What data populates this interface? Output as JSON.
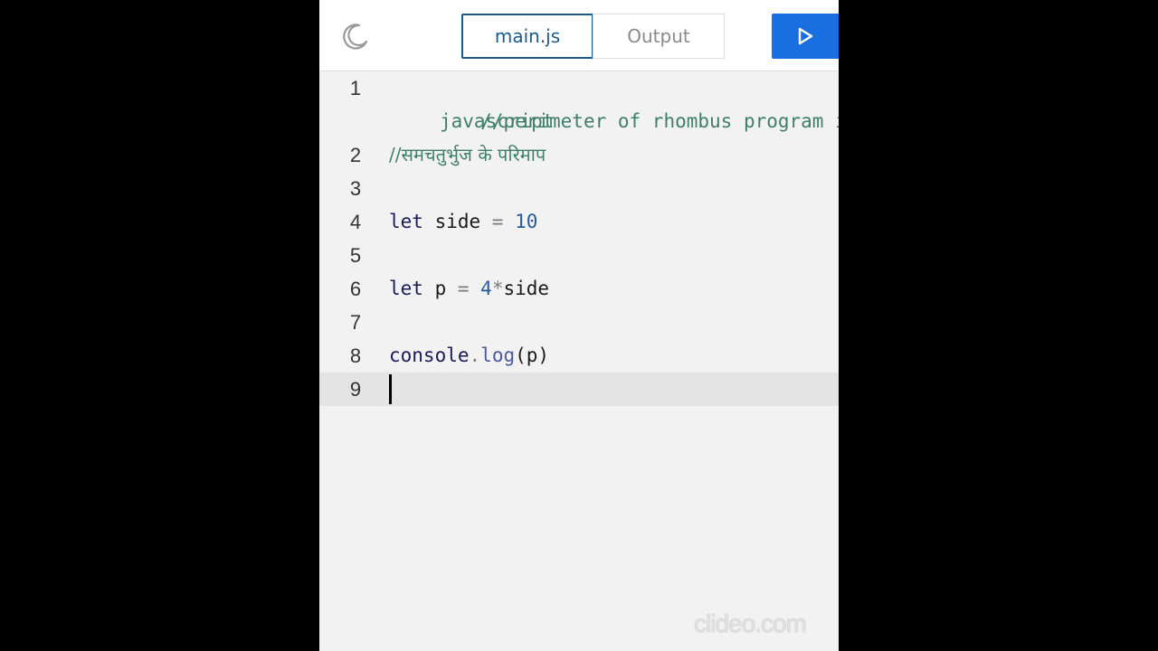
{
  "toolbar": {
    "theme_icon": "moon-icon",
    "tab_main_label": "main.js",
    "tab_output_label": "Output",
    "run_icon": "play-icon",
    "colors": {
      "accent": "#1a5a8a",
      "run_button": "#1a6fe0"
    }
  },
  "editor": {
    "lines": [
      {
        "number": "1",
        "text_a": "//perimeter of rhombus program in",
        "text_b": "javascript"
      },
      {
        "number": "2",
        "text": "//समचतुर्भुज के परिमाप"
      },
      {
        "number": "3",
        "text": ""
      },
      {
        "number": "4",
        "kw": "let",
        "ident": " side ",
        "op": "=",
        "num": " 10"
      },
      {
        "number": "5",
        "text": ""
      },
      {
        "number": "6",
        "kw": "let",
        "ident": " p ",
        "op": "=",
        "num": " 4",
        "op2": "*",
        "ident2": "side"
      },
      {
        "number": "7",
        "text": ""
      },
      {
        "number": "8",
        "obj": "console",
        "dot": ".",
        "fn": "log",
        "args": "(p)"
      },
      {
        "number": "9",
        "text": ""
      }
    ]
  },
  "watermark": "clideo.com"
}
